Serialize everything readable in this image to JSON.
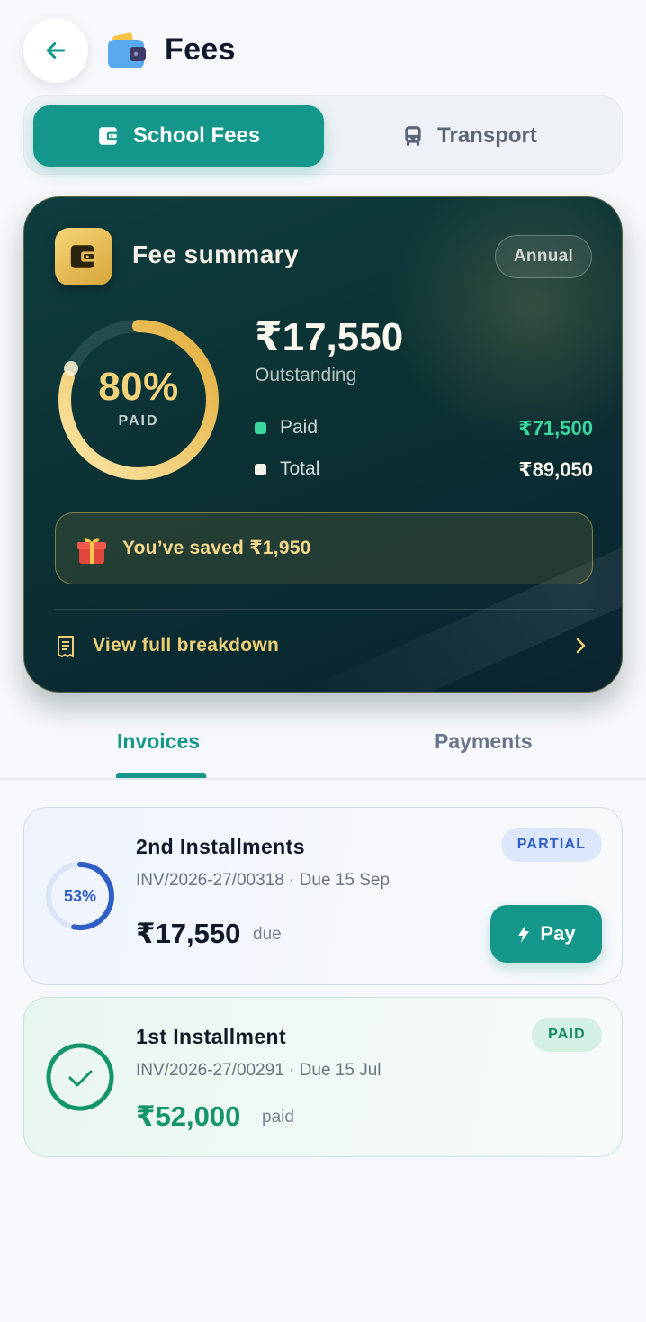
{
  "header": {
    "title": "Fees",
    "back_icon": "arrow-left-icon",
    "title_icon": "wallet-icon"
  },
  "fee_type_tabs": [
    {
      "label": "School Fees",
      "icon": "wallet-icon",
      "active": true
    },
    {
      "label": "Transport",
      "icon": "bus-icon",
      "active": false
    }
  ],
  "summary": {
    "title": "Fee summary",
    "period": "Annual",
    "paid_percent": 80,
    "paid_percent_label": "80%",
    "paid_caption": "PAID",
    "outstanding_amount": "₹17,550",
    "outstanding_label": "Outstanding",
    "legend": [
      {
        "label": "Paid",
        "value": "₹71,500",
        "color": "#3ad79e"
      },
      {
        "label": "Total",
        "value": "₹89,050",
        "color": "#f4f1e8"
      }
    ],
    "saved_text": "You’ve saved ₹1,950",
    "breakdown_label": "View full breakdown"
  },
  "list_tabs": [
    {
      "label": "Invoices",
      "active": true
    },
    {
      "label": "Payments",
      "active": false
    }
  ],
  "invoices": [
    {
      "title": "2nd Installments",
      "meta": "INV/2026-27/00318 · Due 15 Sep",
      "status": "PARTIAL",
      "progress_percent": 53,
      "progress_label": "53%",
      "amount": "₹17,550",
      "amount_suffix": "due",
      "action_label": "Pay"
    },
    {
      "title": "1st Installment",
      "meta": "INV/2026-27/00291 · Due 15 Jul",
      "status": "PAID",
      "amount": "₹52,000",
      "amount_suffix": "paid"
    }
  ],
  "colors": {
    "accent": "#14978a",
    "gold": "#f3d27a",
    "partial_blue": "#2f5fc4",
    "paid_green": "#148a63"
  }
}
